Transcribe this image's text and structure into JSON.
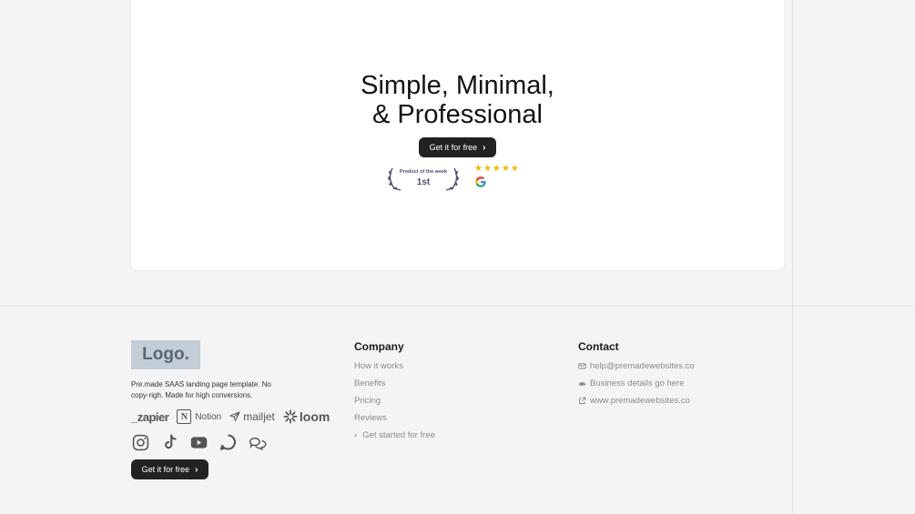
{
  "hero": {
    "title_line1": "Simple, Minimal,",
    "title_line2": "& Professional",
    "cta_label": "Get it for free",
    "badge_top": "Product of the week",
    "badge_rank": "1st",
    "stars": "★★★★★",
    "rating_source_icon": "google-icon"
  },
  "footer": {
    "logo": "Logo.",
    "description": "Pre.made SAAS landing page template. No copy-righ. Made for high conversions.",
    "brands": {
      "zapier": "_zapier",
      "notion_mark": "N",
      "notion": "Notion",
      "mailjet": "mailjet",
      "loom": "loom"
    },
    "socials": [
      "instagram-icon",
      "tiktok-icon",
      "youtube-icon",
      "threads-icon",
      "chat-icon"
    ],
    "cta_label": "Get it for free",
    "company": {
      "title": "Company",
      "links": [
        "How it works",
        "Benefits",
        "Pricing",
        "Reviews"
      ],
      "cta_link": "Get started for free"
    },
    "contact": {
      "title": "Contact",
      "email": "help@premadewebsites.co",
      "business": "Business details go here",
      "website": "www.premadewebsites.co"
    }
  },
  "colors": {
    "background": "#f4f4f4",
    "card": "#ffffff",
    "button": "#222222",
    "star": "#f5b800",
    "logo_bg": "#c2cdd6"
  }
}
